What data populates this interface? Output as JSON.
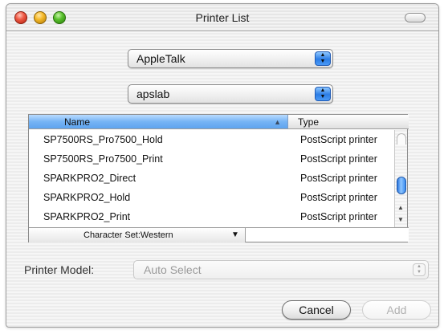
{
  "window": {
    "title": "Printer List"
  },
  "connection_popup": {
    "selected": "AppleTalk"
  },
  "zone_popup": {
    "selected": "apslab"
  },
  "printer_list": {
    "columns": {
      "name": "Name",
      "type": "Type"
    },
    "rows": [
      {
        "name": "SP7500RS_Pro7500_Hold",
        "type": "PostScript printer"
      },
      {
        "name": "SP7500RS_Pro7500_Print",
        "type": "PostScript printer"
      },
      {
        "name": "SPARKPRO2_Direct",
        "type": "PostScript printer"
      },
      {
        "name": "SPARKPRO2_Hold",
        "type": "PostScript printer"
      },
      {
        "name": "SPARKPRO2_Print",
        "type": "PostScript printer"
      }
    ],
    "character_set": "Character Set:Western"
  },
  "printer_model": {
    "label": "Printer Model:",
    "selected": "Auto Select"
  },
  "buttons": {
    "cancel": "Cancel",
    "add": "Add"
  },
  "icons": {
    "close": "close-icon",
    "minimize": "minimize-icon",
    "zoom": "zoom-icon",
    "popup_arrows": "chevron-up-down-icon",
    "sort": "sort-ascending-icon"
  },
  "colors": {
    "selection_blue": "#5ea4ef",
    "aqua_accent": "#2c7de5",
    "disabled_text": "#9a9a9a"
  }
}
